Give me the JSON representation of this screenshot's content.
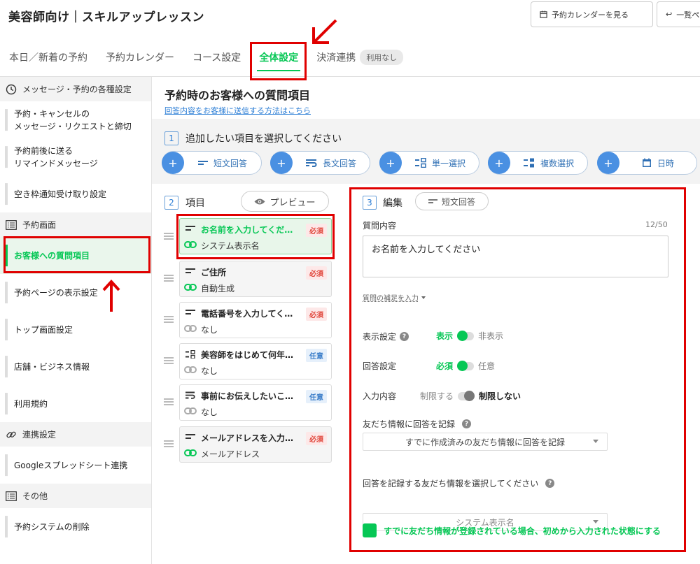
{
  "app": {
    "title": "美容師向け｜スキルアップレッスン"
  },
  "topbar": {
    "calendar_button": "予約カレンダーを見る",
    "list_button": "一覧ペ"
  },
  "tabs": [
    {
      "label": "本日／新着の予約"
    },
    {
      "label": "予約カレンダー"
    },
    {
      "label": "コース設定"
    },
    {
      "label": "全体設定"
    },
    {
      "label": "決済連携"
    }
  ],
  "tab_badge": "利用なし",
  "sidebar": {
    "sections": [
      {
        "label": "メッセージ・予約の各種設定",
        "icon": "clock-icon"
      },
      {
        "label": "予約画面",
        "icon": "list-icon"
      },
      {
        "label": "連携設定",
        "icon": "link-icon"
      },
      {
        "label": "その他",
        "icon": "list-icon"
      }
    ],
    "items": [
      {
        "label": "予約・キャンセルの\nメッセージ・リクエストと締切"
      },
      {
        "label": "予約前後に送る\nリマインドメッセージ"
      },
      {
        "label": "空き枠通知受け取り設定"
      },
      {
        "label": "お客様への質問項目"
      },
      {
        "label": "予約ページの表示設定"
      },
      {
        "label": "トップ画面設定"
      },
      {
        "label": "店舗・ビジネス情報"
      },
      {
        "label": "利用規約"
      },
      {
        "label": "Googleスプレッドシート連携"
      },
      {
        "label": "予約システムの削除"
      }
    ]
  },
  "main": {
    "title": "予約時のお客様への質問項目",
    "help_link": "回答内容をお客様に送信する方法はこちら",
    "step1": {
      "num": "1",
      "label": "追加したい項目を選択してください"
    },
    "add_buttons": [
      {
        "label": "短文回答",
        "icon": "short-text-icon"
      },
      {
        "label": "長文回答",
        "icon": "long-text-icon"
      },
      {
        "label": "単一選択",
        "icon": "single-select-icon"
      },
      {
        "label": "複数選択",
        "icon": "multi-select-icon"
      },
      {
        "label": "日時",
        "icon": "calendar-icon"
      }
    ],
    "step2": {
      "num": "2",
      "label": "項目",
      "preview": "プレビュー"
    },
    "questions": [
      {
        "title": "お名前を入力してください",
        "sub": "システム表示名",
        "badge": "必須",
        "required": true,
        "icon": "short-text-icon",
        "link_active": true
      },
      {
        "title": "ご住所",
        "sub": "自動生成",
        "badge": "必須",
        "required": true,
        "icon": "short-text-icon",
        "link_active": true
      },
      {
        "title": "電話番号を入力してください",
        "sub": "なし",
        "badge": "必須",
        "required": true,
        "icon": "short-text-icon",
        "link_active": false
      },
      {
        "title": "美容師をはじめて何年目ですか",
        "sub": "なし",
        "badge": "任意",
        "required": false,
        "icon": "single-select-icon",
        "link_active": false
      },
      {
        "title": "事前にお伝えしたいことがあれば",
        "sub": "なし",
        "badge": "任意",
        "required": false,
        "icon": "long-text-icon",
        "link_active": false
      },
      {
        "title": "メールアドレスを入力してください",
        "sub": "メールアドレス",
        "badge": "必須",
        "required": true,
        "icon": "short-text-icon",
        "link_active": true
      }
    ],
    "step3": {
      "num": "3",
      "label": "編集",
      "type_chip": "短文回答"
    },
    "editor": {
      "question_label": "質問内容",
      "char_count": "12/50",
      "question_value": "お名前を入力してください",
      "supplement_link": "質問の補足を入力",
      "display_label": "表示設定",
      "display_on": "表示",
      "display_off": "非表示",
      "answer_label": "回答設定",
      "answer_on": "必須",
      "answer_off": "任意",
      "input_label": "入力内容",
      "input_limit": "制限する",
      "input_nolimit": "制限しない",
      "record_label": "友だち情報に回答を記録",
      "record_select": "すでに作成済みの友だち情報に回答を記録",
      "choose_label": "回答を記録する友だち情報を選択してください",
      "choose_select": "システム表示名",
      "prefill_label": "すでに友だち情報が登録されている場合、初めから入力された状態にする"
    }
  },
  "colors": {
    "accent": "#06c755",
    "annotation": "#e00000",
    "link": "#2e7fd6"
  }
}
